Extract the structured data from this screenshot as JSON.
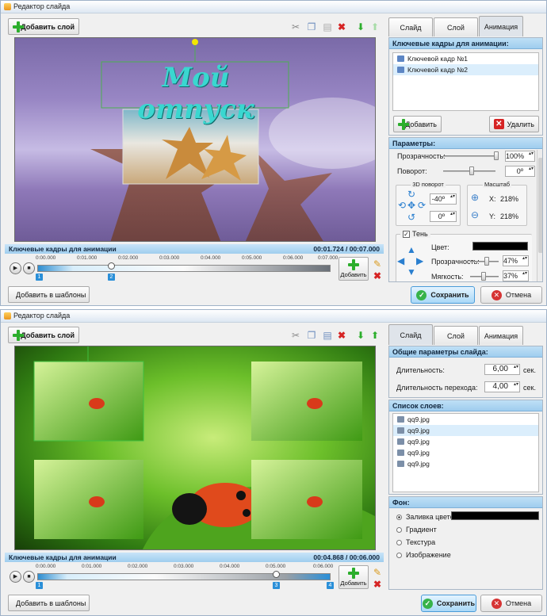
{
  "windows": [
    {
      "title": "Редактор слайда",
      "add_layer_label": "Добавить слой",
      "tabs": [
        "Слайд",
        "Слой",
        "Анимация"
      ],
      "active_tab": 2,
      "keyframes_header": "Ключевые кадры для анимации:",
      "keyframes": [
        "Ключевой кадр №1",
        "Ключевой кадр №2"
      ],
      "add_label": "Добавить",
      "delete_label": "Удалить",
      "params_header": "Параметры:",
      "opacity_label": "Прозрачность:",
      "opacity_value": "100%",
      "rotation_label": "Поворот:",
      "rotation_value": "0º",
      "rot3d_label": "3D поворот",
      "rot3d_a": "-40º",
      "rot3d_b": "0º",
      "scale_label": "Масштаб",
      "scale_x_label": "X:",
      "scale_x": "218%",
      "scale_y_label": "Y:",
      "scale_y": "218%",
      "shadow_label": "Тень",
      "shadow_color_label": "Цвет:",
      "shadow_color": "#000000",
      "shadow_opacity_label": "Прозрачность:",
      "shadow_opacity": "47%",
      "softness_label": "Мягкость:",
      "softness": "37%",
      "canvas_text": "Мой отпуск",
      "timeline_label": "Ключевые кадры для анимации",
      "timeline_time": "00:01.724 / 00:07.000",
      "ruler": [
        "0:00.000",
        "0:01.000",
        "0:02.000",
        "0:03.000",
        "0:04.000",
        "0:05.000",
        "0:06.000",
        "0:07.000"
      ],
      "markers": [
        "1",
        "2"
      ],
      "timeline_add_label": "Добавить",
      "templates_label": "Добавить в шаблоны",
      "save_label": "Сохранить",
      "cancel_label": "Отмена"
    },
    {
      "title": "Редактор слайда",
      "add_layer_label": "Добавить слой",
      "tabs": [
        "Слайд",
        "Слой",
        "Анимация"
      ],
      "active_tab": 0,
      "general_header": "Общие параметры слайда:",
      "duration_label": "Длительность:",
      "duration_value": "6,00",
      "duration_unit": "сек.",
      "transition_label": "Длительность перехода:",
      "transition_value": "4,00",
      "transition_unit": "сек.",
      "layers_header": "Список слоев:",
      "layers": [
        "qq9.jpg",
        "qq9.jpg",
        "qq9.jpg",
        "qq9.jpg",
        "qq9.jpg"
      ],
      "bg_header": "Фон:",
      "bg_options": [
        "Заливка цветом",
        "Градиент",
        "Текстура",
        "Изображение"
      ],
      "bg_selected": 0,
      "bg_color": "#000000",
      "timeline_label": "Ключевые кадры для анимации",
      "timeline_time": "00:04.868 / 00:06.000",
      "ruler": [
        "0:00.000",
        "0:01.000",
        "0:02.000",
        "0:03.000",
        "0:04.000",
        "0:05.000",
        "0:06.000"
      ],
      "markers": [
        "1",
        "3",
        "4"
      ],
      "timeline_add_label": "Добавить",
      "templates_label": "Добавить в шаблоны",
      "save_label": "Сохранить",
      "cancel_label": "Отмена"
    }
  ]
}
